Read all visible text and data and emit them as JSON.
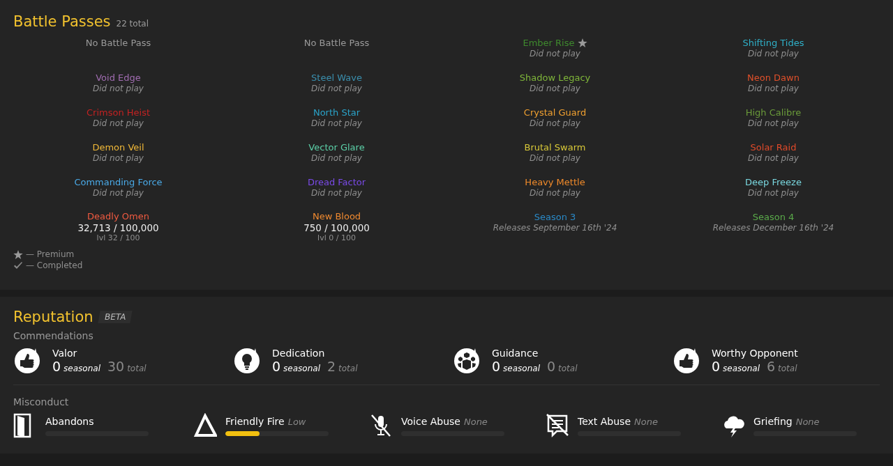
{
  "battle_passes": {
    "title": "Battle Passes",
    "count": "22 total",
    "items": [
      {
        "kind": "none",
        "name": "No Battle Pass",
        "premium": false
      },
      {
        "kind": "none",
        "name": "No Battle Pass",
        "premium": false
      },
      {
        "kind": "unplayed",
        "name": "Ember Rise",
        "color": "#3f8a2e",
        "premium": true,
        "status": "Did not play"
      },
      {
        "kind": "unplayed",
        "name": "Shifting Tides",
        "color": "#2fb0c8",
        "premium": false,
        "status": "Did not play"
      },
      {
        "kind": "unplayed",
        "name": "Void Edge",
        "color": "#a06cb0",
        "premium": false,
        "status": "Did not play"
      },
      {
        "kind": "unplayed",
        "name": "Steel Wave",
        "color": "#3a8fae",
        "premium": false,
        "status": "Did not play"
      },
      {
        "kind": "unplayed",
        "name": "Shadow Legacy",
        "color": "#7fb63a",
        "premium": false,
        "status": "Did not play"
      },
      {
        "kind": "unplayed",
        "name": "Neon Dawn",
        "color": "#e0502a",
        "premium": false,
        "status": "Did not play"
      },
      {
        "kind": "unplayed",
        "name": "Crimson Heist",
        "color": "#c42222",
        "premium": false,
        "status": "Did not play"
      },
      {
        "kind": "unplayed",
        "name": "North Star",
        "color": "#2aa3c9",
        "premium": false,
        "status": "Did not play"
      },
      {
        "kind": "unplayed",
        "name": "Crystal Guard",
        "color": "#f0a030",
        "premium": false,
        "status": "Did not play"
      },
      {
        "kind": "unplayed",
        "name": "High Calibre",
        "color": "#6a9a3a",
        "premium": false,
        "status": "Did not play"
      },
      {
        "kind": "unplayed",
        "name": "Demon Veil",
        "color": "#f0b838",
        "premium": false,
        "status": "Did not play"
      },
      {
        "kind": "unplayed",
        "name": "Vector Glare",
        "color": "#5cd0a8",
        "premium": false,
        "status": "Did not play"
      },
      {
        "kind": "unplayed",
        "name": "Brutal Swarm",
        "color": "#d8c838",
        "premium": false,
        "status": "Did not play"
      },
      {
        "kind": "unplayed",
        "name": "Solar Raid",
        "color": "#e04a2a",
        "premium": false,
        "status": "Did not play"
      },
      {
        "kind": "unplayed",
        "name": "Commanding Force",
        "color": "#4aaae8",
        "premium": false,
        "status": "Did not play"
      },
      {
        "kind": "unplayed",
        "name": "Dread Factor",
        "color": "#7a4ae8",
        "premium": false,
        "status": "Did not play"
      },
      {
        "kind": "unplayed",
        "name": "Heavy Mettle",
        "color": "#f08a2a",
        "premium": false,
        "status": "Did not play"
      },
      {
        "kind": "unplayed",
        "name": "Deep Freeze",
        "color": "#7ad8e0",
        "premium": false,
        "status": "Did not play"
      },
      {
        "kind": "progress",
        "name": "Deadly Omen",
        "color": "#f05a40",
        "premium": false,
        "points": "32,713 / 100,000",
        "level_text": "lvl 32 / 100"
      },
      {
        "kind": "progress",
        "name": "New Blood",
        "color": "#f08a30",
        "premium": false,
        "points": "750 / 100,000",
        "level_text": "lvl 0 / 100"
      },
      {
        "kind": "upcoming",
        "name": "Season 3",
        "color": "#2a8ac8",
        "premium": false,
        "status": "Releases September 16th '24"
      },
      {
        "kind": "upcoming",
        "name": "Season 4",
        "color": "#5aaa4a",
        "premium": false,
        "status": "Releases December 16th '24"
      }
    ],
    "legend": [
      {
        "kind": "star",
        "text": "— Premium"
      },
      {
        "kind": "check",
        "text": "— Completed"
      }
    ]
  },
  "reputation": {
    "title": "Reputation",
    "badge": "BETA",
    "commendations_label": "Commendations",
    "commendations": [
      {
        "kind": "thumb",
        "name": "Valor",
        "seasonal": "0",
        "seasonal_label": "seasonal",
        "total": "30",
        "total_label": "total"
      },
      {
        "kind": "bulb",
        "name": "Dedication",
        "seasonal": "0",
        "seasonal_label": "seasonal",
        "total": "2",
        "total_label": "total"
      },
      {
        "kind": "group",
        "name": "Guidance",
        "seasonal": "0",
        "seasonal_label": "seasonal",
        "total": "0",
        "total_label": "total"
      },
      {
        "kind": "thumb",
        "name": "Worthy Opponent",
        "seasonal": "0",
        "seasonal_label": "seasonal",
        "total": "6",
        "total_label": "total"
      }
    ],
    "misconduct_label": "Misconduct",
    "misconduct": [
      {
        "kind": "door",
        "name": "Abandons",
        "level": 0
      },
      {
        "kind": "triangle",
        "name": "Friendly Fire",
        "severity": "Low",
        "level": 0.33
      },
      {
        "kind": "mic",
        "name": "Voice Abuse",
        "severity": "None",
        "level": 0
      },
      {
        "kind": "text",
        "name": "Text Abuse",
        "severity": "None",
        "level": 0
      },
      {
        "kind": "storm",
        "name": "Griefing",
        "severity": "None",
        "level": 0
      }
    ]
  }
}
